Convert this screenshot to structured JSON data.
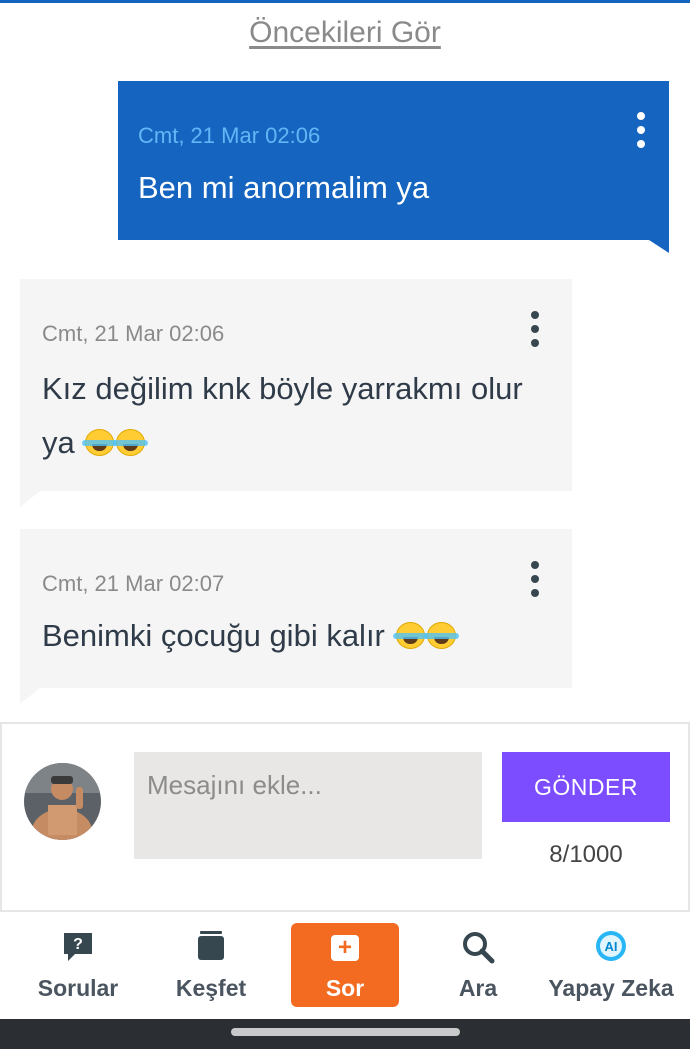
{
  "header": {
    "older_link": "Öncekileri Gör"
  },
  "messages": [
    {
      "time": "Cmt, 21 Mar 02:06",
      "text": "Ben mi anormalim ya",
      "mine": true
    },
    {
      "time": "Cmt, 21 Mar 02:06",
      "text": "Kız değilim knk böyle yarrakmı olur ya",
      "emoji": "😂😂",
      "mine": false
    },
    {
      "time": "Cmt, 21 Mar 02:07",
      "text": "Benimki çocuğu gibi kalır",
      "emoji": "😂😂",
      "mine": false
    }
  ],
  "composer": {
    "placeholder": "Mesajını ekle...",
    "send_label": "GÖNDER",
    "counter": "8/1000"
  },
  "nav": {
    "items": [
      {
        "label": "Sorular",
        "icon": "question-bubble-icon"
      },
      {
        "label": "Keşfet",
        "icon": "stack-icon"
      },
      {
        "label": "Sor",
        "icon": "plus-icon"
      },
      {
        "label": "Ara",
        "icon": "search-icon"
      },
      {
        "label": "Yapay Zeka",
        "icon": "ai-icon"
      }
    ]
  },
  "colors": {
    "accent_blue": "#1565c0",
    "send_purple": "#7c4dff",
    "ask_orange": "#f26b21",
    "bubble_gray": "#f5f5f5"
  }
}
